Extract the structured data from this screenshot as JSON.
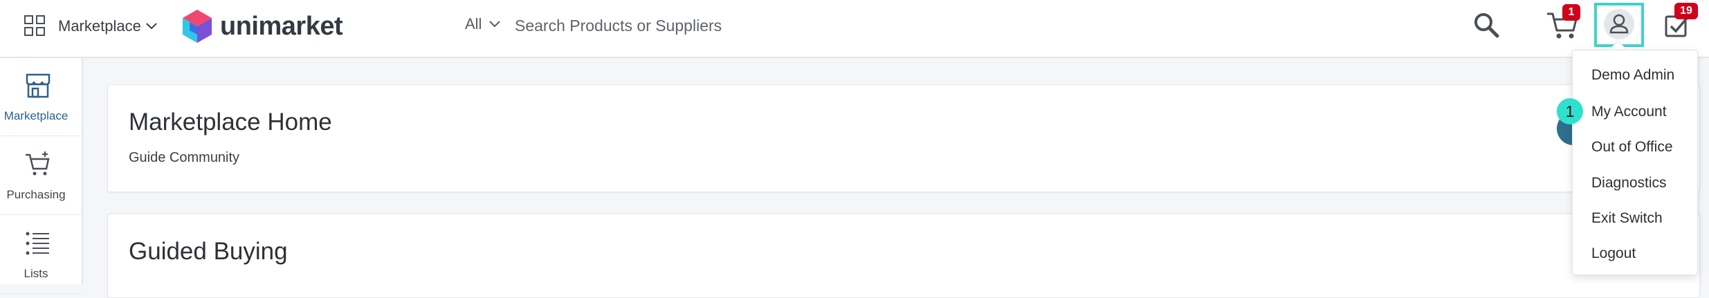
{
  "header": {
    "app_switcher_label": "Marketplace",
    "logo_text": "unimarket",
    "search_scope": "All",
    "search_placeholder": "Search Products or Suppliers",
    "cart_count": "1",
    "tasks_count": "19"
  },
  "sidebar": {
    "items": [
      {
        "label": "Marketplace",
        "icon": "storefront-icon",
        "active": true
      },
      {
        "label": "Purchasing",
        "icon": "cart-plus-icon",
        "active": false
      },
      {
        "label": "Lists",
        "icon": "list-icon",
        "active": false
      }
    ]
  },
  "main": {
    "cards": [
      {
        "title": "Marketplace Home",
        "link": "Guide Community"
      },
      {
        "title": "Guided Buying"
      }
    ]
  },
  "user_menu": {
    "user_name": "Demo Admin",
    "items": [
      "My Account",
      "Out of Office",
      "Diagnostics",
      "Exit Switch",
      "Logout"
    ],
    "step_marker": "1"
  },
  "colors": {
    "accent_teal": "#3fd3c9",
    "badge_red": "#d0021b",
    "nav_active": "#2f5f8a"
  }
}
